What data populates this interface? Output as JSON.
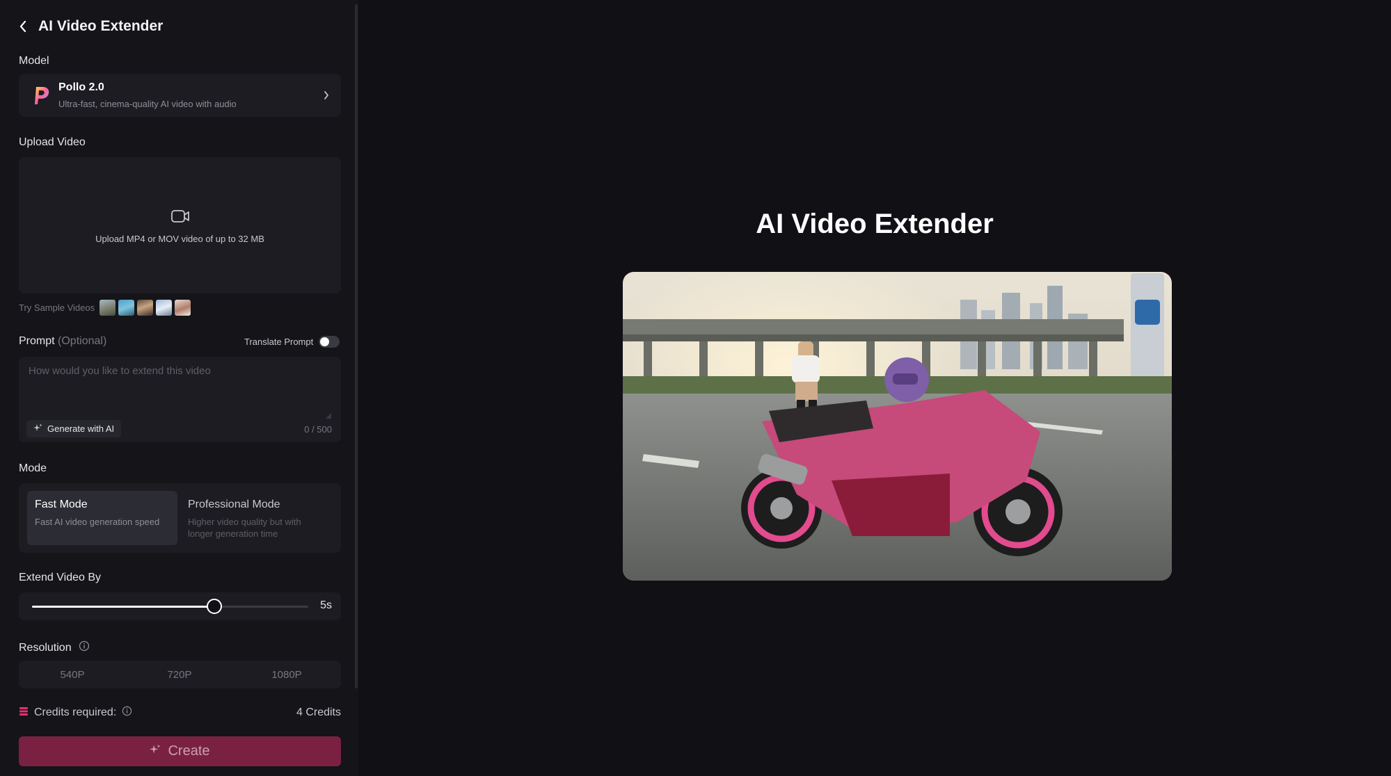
{
  "header": {
    "title": "AI Video Extender"
  },
  "model": {
    "label": "Model",
    "name": "Pollo 2.0",
    "description": "Ultra-fast, cinema-quality AI video with audio"
  },
  "upload": {
    "label": "Upload Video",
    "hint": "Upload MP4 or MOV video of up to 32 MB",
    "samples_label": "Try Sample Videos",
    "sample_count": 5
  },
  "prompt": {
    "label": "Prompt",
    "optional": "(Optional)",
    "translate_label": "Translate Prompt",
    "translate_enabled": false,
    "placeholder": "How would you like to extend this video",
    "generate_label": "Generate with AI",
    "counter": "0 / 500"
  },
  "mode": {
    "label": "Mode",
    "options": [
      {
        "title": "Fast Mode",
        "desc": "Fast AI video generation speed",
        "active": true
      },
      {
        "title": "Professional Mode",
        "desc": "Higher video quality but with longer generation time",
        "active": false
      }
    ]
  },
  "extend": {
    "label": "Extend Video By",
    "value_fraction": 0.66,
    "value_label": "5s"
  },
  "resolution": {
    "label": "Resolution",
    "options": [
      "540P",
      "720P",
      "1080P"
    ],
    "selected": "540P"
  },
  "credits": {
    "label": "Credits required:",
    "value": "4 Credits"
  },
  "create": {
    "label": "Create"
  },
  "main": {
    "title": "AI Video Extender"
  },
  "colors": {
    "background": "#101015",
    "sidebar": "#141419",
    "card": "#1c1c22",
    "accent": "#7a2142",
    "credit_icon": "#e0336e"
  },
  "icons": {
    "back": "chevron-left-icon",
    "model_logo": "pollo-logo",
    "model_chevron": "chevron-right-icon",
    "upload": "video-camera-icon",
    "generate": "sparkle-icon",
    "resolution_info": "info-icon",
    "credits": "credits-icon",
    "create": "sparkle-icon"
  }
}
